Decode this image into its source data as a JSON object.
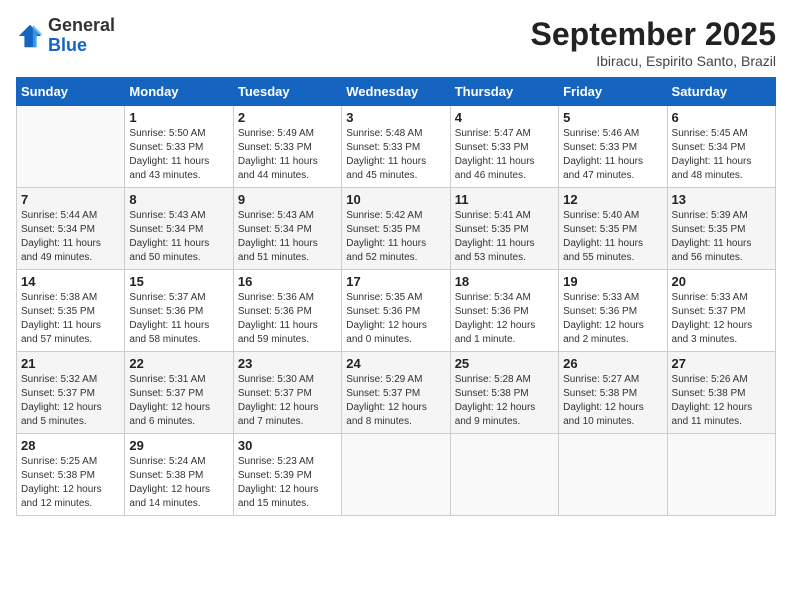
{
  "header": {
    "logo_general": "General",
    "logo_blue": "Blue",
    "month_title": "September 2025",
    "subtitle": "Ibiracu, Espirito Santo, Brazil"
  },
  "columns": [
    "Sunday",
    "Monday",
    "Tuesday",
    "Wednesday",
    "Thursday",
    "Friday",
    "Saturday"
  ],
  "weeks": [
    [
      {
        "day": "",
        "info": ""
      },
      {
        "day": "1",
        "info": "Sunrise: 5:50 AM\nSunset: 5:33 PM\nDaylight: 11 hours\nand 43 minutes."
      },
      {
        "day": "2",
        "info": "Sunrise: 5:49 AM\nSunset: 5:33 PM\nDaylight: 11 hours\nand 44 minutes."
      },
      {
        "day": "3",
        "info": "Sunrise: 5:48 AM\nSunset: 5:33 PM\nDaylight: 11 hours\nand 45 minutes."
      },
      {
        "day": "4",
        "info": "Sunrise: 5:47 AM\nSunset: 5:33 PM\nDaylight: 11 hours\nand 46 minutes."
      },
      {
        "day": "5",
        "info": "Sunrise: 5:46 AM\nSunset: 5:33 PM\nDaylight: 11 hours\nand 47 minutes."
      },
      {
        "day": "6",
        "info": "Sunrise: 5:45 AM\nSunset: 5:34 PM\nDaylight: 11 hours\nand 48 minutes."
      }
    ],
    [
      {
        "day": "7",
        "info": "Sunrise: 5:44 AM\nSunset: 5:34 PM\nDaylight: 11 hours\nand 49 minutes."
      },
      {
        "day": "8",
        "info": "Sunrise: 5:43 AM\nSunset: 5:34 PM\nDaylight: 11 hours\nand 50 minutes."
      },
      {
        "day": "9",
        "info": "Sunrise: 5:43 AM\nSunset: 5:34 PM\nDaylight: 11 hours\nand 51 minutes."
      },
      {
        "day": "10",
        "info": "Sunrise: 5:42 AM\nSunset: 5:35 PM\nDaylight: 11 hours\nand 52 minutes."
      },
      {
        "day": "11",
        "info": "Sunrise: 5:41 AM\nSunset: 5:35 PM\nDaylight: 11 hours\nand 53 minutes."
      },
      {
        "day": "12",
        "info": "Sunrise: 5:40 AM\nSunset: 5:35 PM\nDaylight: 11 hours\nand 55 minutes."
      },
      {
        "day": "13",
        "info": "Sunrise: 5:39 AM\nSunset: 5:35 PM\nDaylight: 11 hours\nand 56 minutes."
      }
    ],
    [
      {
        "day": "14",
        "info": "Sunrise: 5:38 AM\nSunset: 5:35 PM\nDaylight: 11 hours\nand 57 minutes."
      },
      {
        "day": "15",
        "info": "Sunrise: 5:37 AM\nSunset: 5:36 PM\nDaylight: 11 hours\nand 58 minutes."
      },
      {
        "day": "16",
        "info": "Sunrise: 5:36 AM\nSunset: 5:36 PM\nDaylight: 11 hours\nand 59 minutes."
      },
      {
        "day": "17",
        "info": "Sunrise: 5:35 AM\nSunset: 5:36 PM\nDaylight: 12 hours\nand 0 minutes."
      },
      {
        "day": "18",
        "info": "Sunrise: 5:34 AM\nSunset: 5:36 PM\nDaylight: 12 hours\nand 1 minute."
      },
      {
        "day": "19",
        "info": "Sunrise: 5:33 AM\nSunset: 5:36 PM\nDaylight: 12 hours\nand 2 minutes."
      },
      {
        "day": "20",
        "info": "Sunrise: 5:33 AM\nSunset: 5:37 PM\nDaylight: 12 hours\nand 3 minutes."
      }
    ],
    [
      {
        "day": "21",
        "info": "Sunrise: 5:32 AM\nSunset: 5:37 PM\nDaylight: 12 hours\nand 5 minutes."
      },
      {
        "day": "22",
        "info": "Sunrise: 5:31 AM\nSunset: 5:37 PM\nDaylight: 12 hours\nand 6 minutes."
      },
      {
        "day": "23",
        "info": "Sunrise: 5:30 AM\nSunset: 5:37 PM\nDaylight: 12 hours\nand 7 minutes."
      },
      {
        "day": "24",
        "info": "Sunrise: 5:29 AM\nSunset: 5:37 PM\nDaylight: 12 hours\nand 8 minutes."
      },
      {
        "day": "25",
        "info": "Sunrise: 5:28 AM\nSunset: 5:38 PM\nDaylight: 12 hours\nand 9 minutes."
      },
      {
        "day": "26",
        "info": "Sunrise: 5:27 AM\nSunset: 5:38 PM\nDaylight: 12 hours\nand 10 minutes."
      },
      {
        "day": "27",
        "info": "Sunrise: 5:26 AM\nSunset: 5:38 PM\nDaylight: 12 hours\nand 11 minutes."
      }
    ],
    [
      {
        "day": "28",
        "info": "Sunrise: 5:25 AM\nSunset: 5:38 PM\nDaylight: 12 hours\nand 12 minutes."
      },
      {
        "day": "29",
        "info": "Sunrise: 5:24 AM\nSunset: 5:38 PM\nDaylight: 12 hours\nand 14 minutes."
      },
      {
        "day": "30",
        "info": "Sunrise: 5:23 AM\nSunset: 5:39 PM\nDaylight: 12 hours\nand 15 minutes."
      },
      {
        "day": "",
        "info": ""
      },
      {
        "day": "",
        "info": ""
      },
      {
        "day": "",
        "info": ""
      },
      {
        "day": "",
        "info": ""
      }
    ]
  ]
}
